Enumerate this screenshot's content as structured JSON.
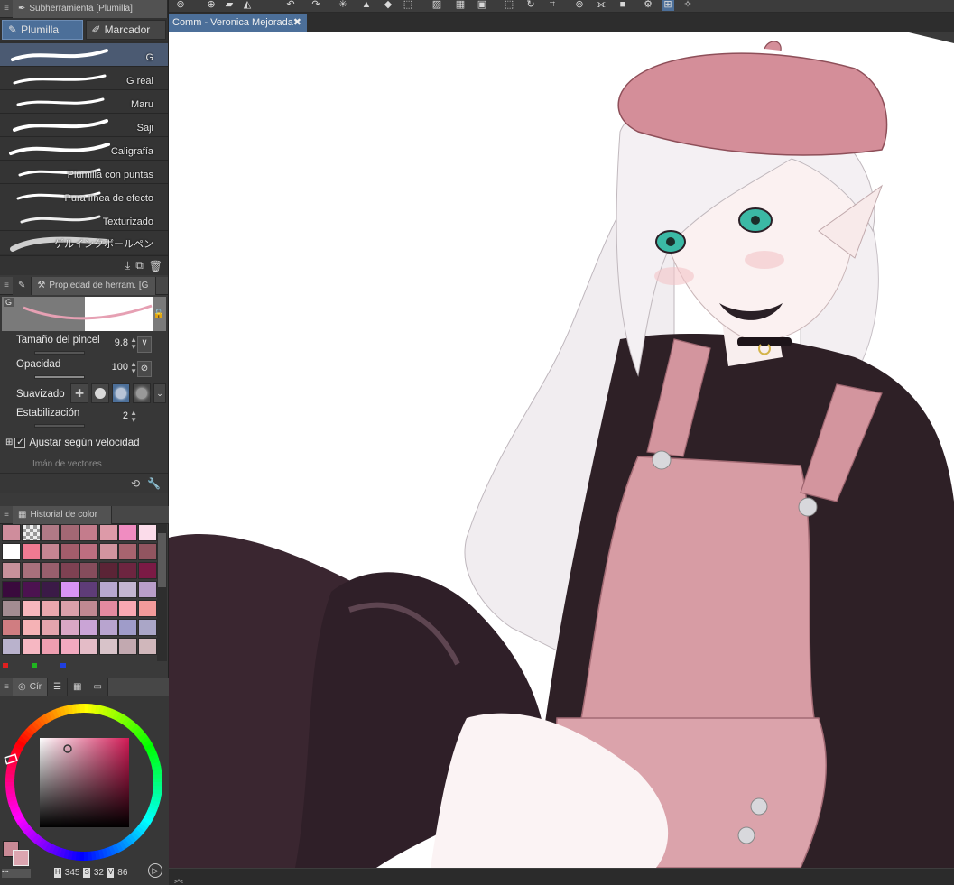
{
  "subtool_panel": {
    "title": "Subherramienta [Plumilla]",
    "tabs": [
      "Plumilla",
      "Marcador"
    ],
    "brushes": [
      "G",
      "G real",
      "Maru",
      "Saji",
      "Caligrafía",
      "Plumilla con puntas",
      "Pura línea de efecto",
      "Texturizado",
      "ゲルインクボールペン"
    ],
    "selected_brush": "G"
  },
  "property_panel": {
    "title": "Propiedad de herram. [G",
    "preview_label": "G",
    "brush_size_label": "Tamaño del pincel",
    "brush_size_value": "9.8",
    "opacity_label": "Opacidad",
    "opacity_value": "100",
    "smoothing_label": "Suavizado",
    "stabilization_label": "Estabilización",
    "stabilization_value": "2",
    "speed_label": "Ajustar según velocidad",
    "vector_label": "Imán de vectores"
  },
  "color_history": {
    "title": "Historial de color",
    "swatches": [
      [
        "#cf8d9c",
        "transparent",
        "#b07a86",
        "#a36874",
        "#c47c8c",
        "#dd9aa8",
        "#f08cc1",
        "#fbdcea"
      ],
      [
        "#ffffff",
        "#f07a92",
        "#c58592",
        "#a35d6b",
        "#bd6e80",
        "#d2949f",
        "#a8646f",
        "#925560"
      ],
      [
        "#c7919b",
        "#a8707c",
        "#985f6d",
        "#7e4152",
        "#854c5c",
        "#5b2436",
        "#6d2540",
        "#7b1a45"
      ],
      [
        "#3a0a3d",
        "#4c1250",
        "#3b1a47",
        "#d894f4",
        "#5e3c78",
        "#b7a8cf",
        "#c3b6d1",
        "#b99ec9"
      ],
      [
        "#a38c92",
        "#f7b7bd",
        "#e9a7ad",
        "#d9a0aa",
        "#bf8992",
        "#e48aa0",
        "#f9a8b2",
        "#f39b9b"
      ],
      [
        "#d07d81",
        "#f5b2b5",
        "#e3a5ad",
        "#d9a7c5",
        "#caa4d6",
        "#b8a4cf",
        "#9f9cc9",
        "#aaa6c7"
      ],
      [
        "#b9b2cc",
        "#f6b7c2",
        "#ee9eb0",
        "#f2a9bf",
        "#e4bcc7",
        "#d8c3c9",
        "#c2a9b0",
        "#d0b7bb"
      ]
    ],
    "accent_colors": [
      "#e01f1f",
      "#1fb51f",
      "#1f3fe0"
    ]
  },
  "color_wheel": {
    "tab_label": "Cír",
    "main_color": "#c98a96",
    "sub_color": "#dca5b0",
    "h_value": "345",
    "s_value": "32",
    "v_value": "86"
  },
  "document": {
    "tab_title": "Comm - Veronica Mejorada",
    "close_label": "✖"
  },
  "colors": {
    "accent": "#4c6f99",
    "panel_bg": "#3a3a3a",
    "canvas_bg": "#ffffff"
  }
}
